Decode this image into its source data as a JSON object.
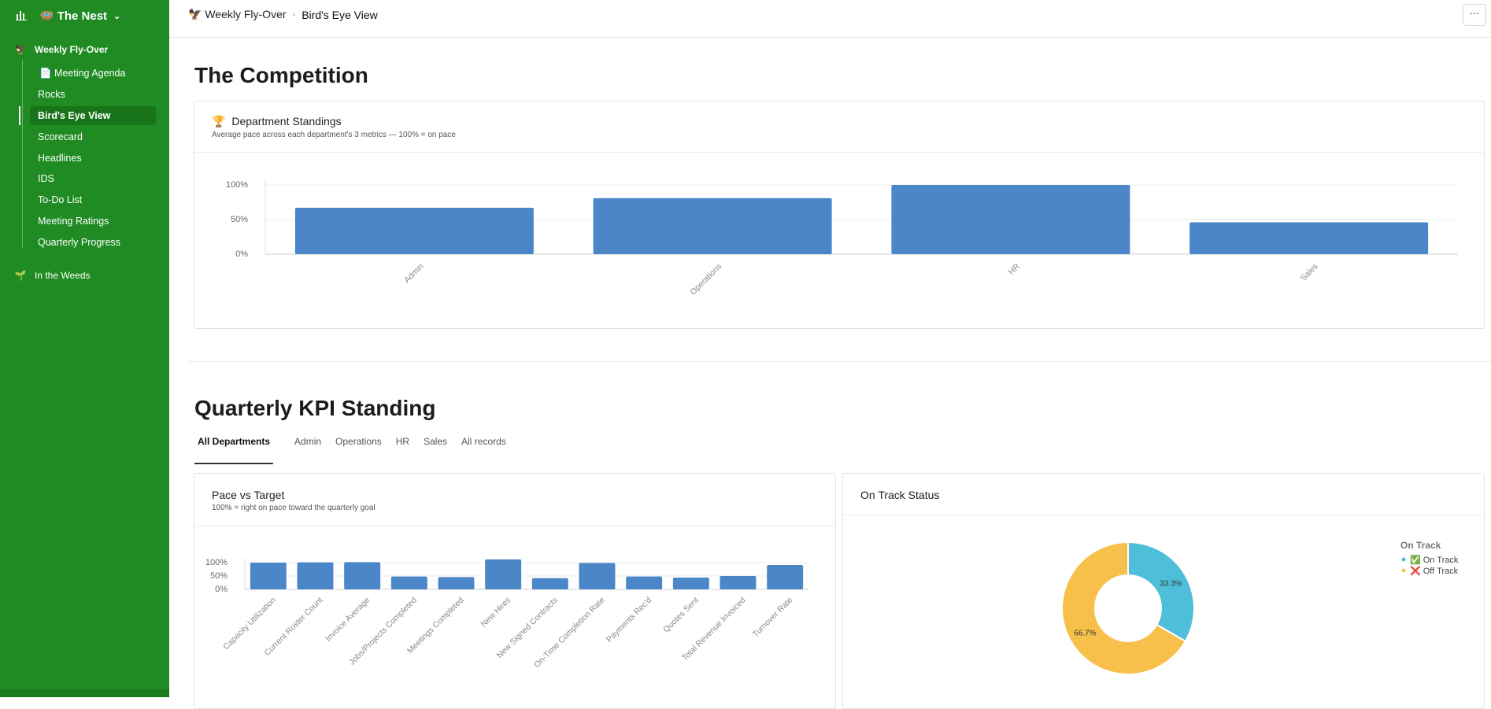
{
  "app": {
    "name": "The Nest",
    "name_emoji": "🪺"
  },
  "sidebar": {
    "sections": [
      {
        "label": "Weekly Fly-Over",
        "icon": "🦅"
      },
      {
        "label": "In the Weeds",
        "icon": "🌱"
      }
    ],
    "items": [
      {
        "label": "📄 Meeting Agenda"
      },
      {
        "label": "Rocks"
      },
      {
        "label": "Bird's Eye View"
      },
      {
        "label": "Scorecard"
      },
      {
        "label": "Headlines"
      },
      {
        "label": "IDS"
      },
      {
        "label": "To-Do List"
      },
      {
        "label": "Meeting Ratings"
      },
      {
        "label": "Quarterly Progress"
      }
    ]
  },
  "breadcrumb": {
    "parent": "🦅 Weekly Fly-Over",
    "current": "Bird's Eye View"
  },
  "toolbar": {
    "more_label": "···"
  },
  "competition": {
    "title": "The Competition",
    "card_icon": "🏆",
    "card_title": "Department Standings",
    "card_subtitle": "Average pace across each department's 3 metrics — 100% = on pace"
  },
  "kpi": {
    "title": "Quarterly KPI Standing",
    "tabs": [
      "All Departments",
      "Admin",
      "Operations",
      "HR",
      "Sales",
      "All records"
    ],
    "active_tab": "All Departments",
    "pace_card_title": "Pace vs Target",
    "pace_card_subtitle": "100% = right on pace toward the quarterly goal",
    "status_card_title": "On Track Status"
  },
  "chart_data": [
    {
      "type": "bar",
      "title": "Department Standings",
      "categories": [
        "Admin",
        "Operations",
        "HR",
        "Sales"
      ],
      "values": [
        67,
        81,
        100,
        46
      ],
      "yticks": [
        "0%",
        "50%",
        "100%"
      ],
      "ylim": [
        0,
        100
      ],
      "grid": true,
      "color": "#4a86c8"
    },
    {
      "type": "bar",
      "title": "Pace vs Target",
      "categories": [
        "Capacity Utilization",
        "Current Roster Count",
        "Invoice Average",
        "Jobs/Projects Completed",
        "Meetings Completed",
        "New Hires",
        "New Signed Contracts",
        "On-Time Completion Rate",
        "Payments Rec'd",
        "Quotes Sent",
        "Total Revenue Invoiced",
        "Turnover Rate"
      ],
      "values": [
        100,
        101,
        102,
        48,
        46,
        112,
        42,
        99,
        48,
        44,
        50,
        91
      ],
      "yticks": [
        "0%",
        "50%",
        "100%"
      ],
      "ylim": [
        0,
        110
      ],
      "grid": true,
      "color": "#4a86c8"
    },
    {
      "type": "pie",
      "title": "On Track Status",
      "legend_title": "On Track",
      "legend_position": "top-right",
      "slices": [
        {
          "label": "✅ On Track",
          "value": 33.3,
          "display": "33.3%",
          "color": "#4fbfd9"
        },
        {
          "label": "❌ Off Track",
          "value": 66.7,
          "display": "66.7%",
          "color": "#f7c04a"
        }
      ]
    }
  ]
}
